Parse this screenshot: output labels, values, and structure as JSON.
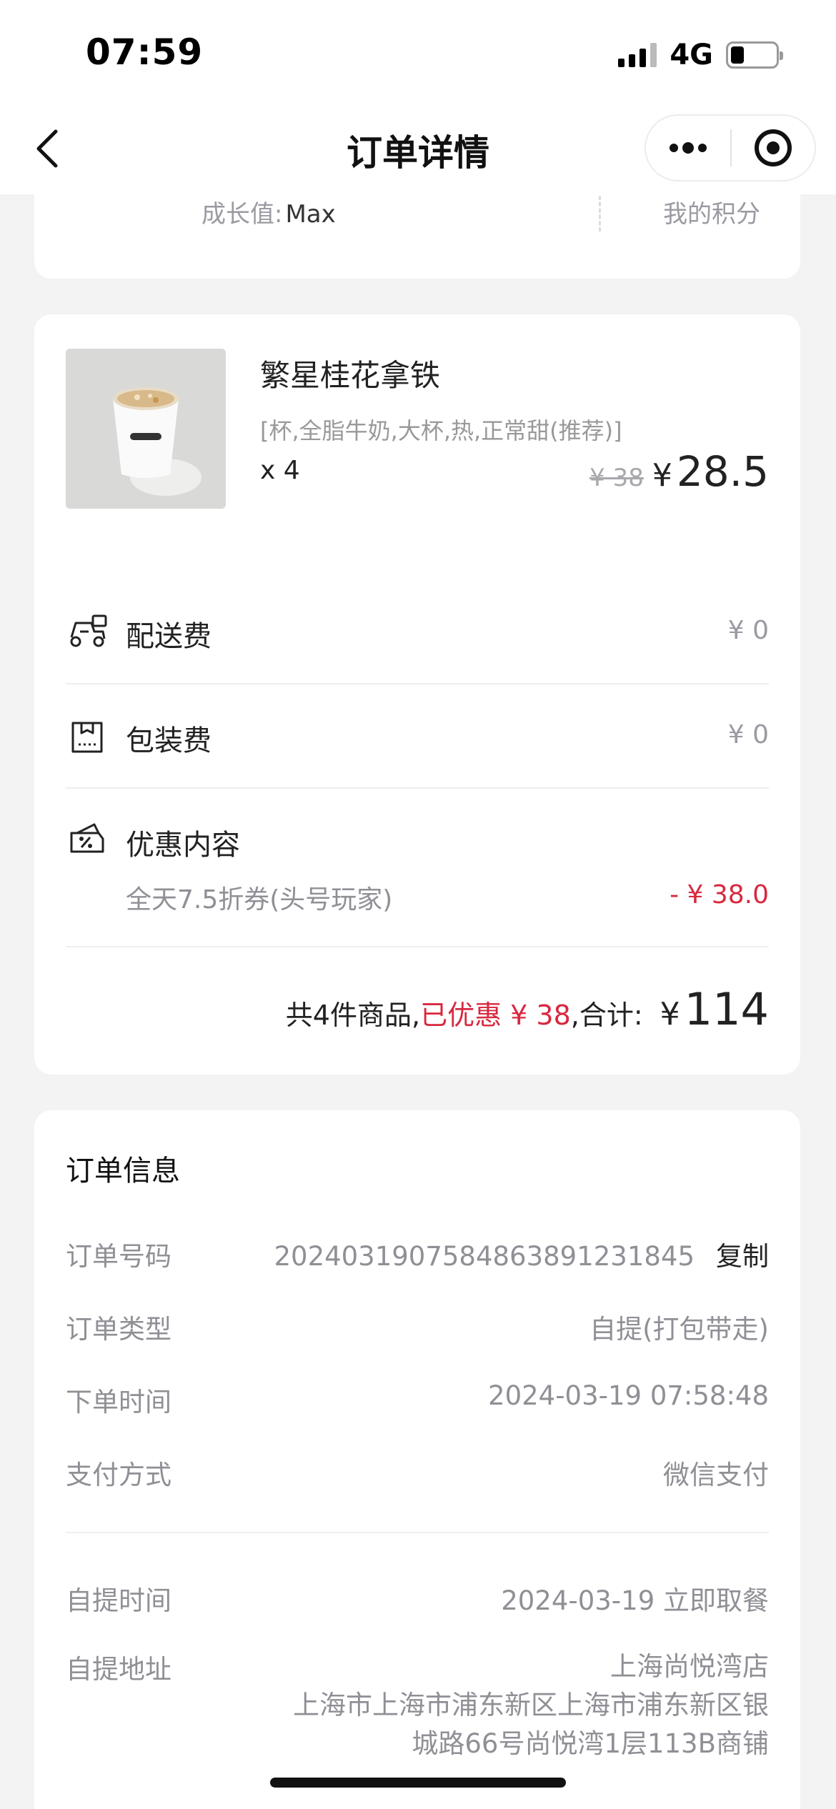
{
  "status_bar": {
    "time": "07:59",
    "network": "4G"
  },
  "nav": {
    "title": "订单详情"
  },
  "member": {
    "growth_label": "成长值:",
    "growth_value": "Max",
    "points_label": "我的积分"
  },
  "product": {
    "name": "繁星桂花拿铁",
    "spec": "[杯,全脂牛奶,大杯,热,正常甜(推荐)]",
    "quantity": "x 4",
    "original_price": "¥ 38",
    "currency": "¥",
    "price": "28.5"
  },
  "fees": {
    "delivery_label": "配送费",
    "delivery_amount": "¥ 0",
    "packing_label": "包装费",
    "packing_amount": "¥ 0",
    "discount_label": "优惠内容",
    "discount_name": "全天7.5折券(头号玩家)",
    "discount_amount": "- ¥ 38.0"
  },
  "total": {
    "count_text": "共4件商品,",
    "saved_text": "已优惠 ¥ 38",
    "sum_label": ",合计:",
    "currency": "¥",
    "sum_value": "114"
  },
  "order_info": {
    "title": "订单信息",
    "number_label": "订单号码",
    "number_value": "2024031907584863891231845",
    "copy_label": "复制",
    "type_label": "订单类型",
    "type_value": "自提(打包带走)",
    "time_label": "下单时间",
    "time_value": "2024-03-19 07:58:48",
    "payment_label": "支付方式",
    "payment_value": "微信支付",
    "pickup_time_label": "自提时间",
    "pickup_time_value": "2024-03-19 立即取餐",
    "pickup_addr_label": "自提地址",
    "store_name": "上海尚悦湾店",
    "address_line1": "上海市上海市浦东新区上海市浦东新区银",
    "address_line2": "城路66号尚悦湾1层113B商铺"
  },
  "colors": {
    "accent_red": "#d8283f",
    "background": "#f3f3f4"
  }
}
